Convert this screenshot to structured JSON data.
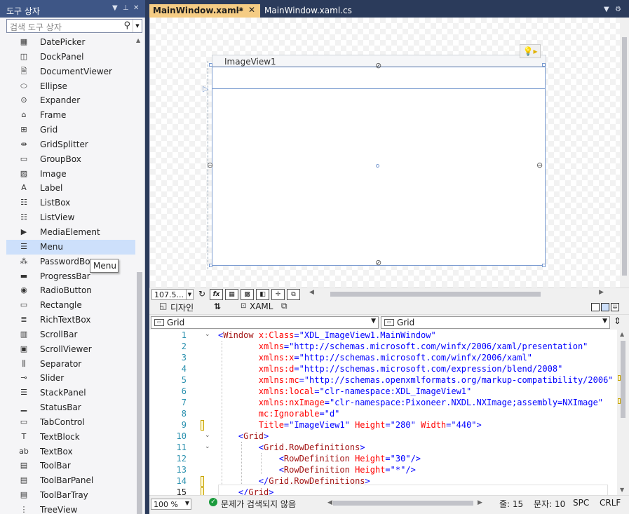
{
  "toolbox": {
    "title": "도구 상자",
    "search_placeholder": "검색 도구 상자",
    "items": [
      {
        "label": "DatePicker",
        "icon": "▦"
      },
      {
        "label": "DockPanel",
        "icon": "◫"
      },
      {
        "label": "DocumentViewer",
        "icon": "🗎"
      },
      {
        "label": "Ellipse",
        "icon": "⬭"
      },
      {
        "label": "Expander",
        "icon": "⊙"
      },
      {
        "label": "Frame",
        "icon": "⌂"
      },
      {
        "label": "Grid",
        "icon": "⊞"
      },
      {
        "label": "GridSplitter",
        "icon": "⇹"
      },
      {
        "label": "GroupBox",
        "icon": "▭"
      },
      {
        "label": "Image",
        "icon": "▨"
      },
      {
        "label": "Label",
        "icon": "A"
      },
      {
        "label": "ListBox",
        "icon": "☷"
      },
      {
        "label": "ListView",
        "icon": "☷"
      },
      {
        "label": "MediaElement",
        "icon": "▶"
      },
      {
        "label": "Menu",
        "icon": "☰",
        "selected": true
      },
      {
        "label": "PasswordBox",
        "icon": "⁂"
      },
      {
        "label": "ProgressBar",
        "icon": "▬"
      },
      {
        "label": "RadioButton",
        "icon": "◉"
      },
      {
        "label": "Rectangle",
        "icon": "▭"
      },
      {
        "label": "RichTextBox",
        "icon": "≣"
      },
      {
        "label": "ScrollBar",
        "icon": "▥"
      },
      {
        "label": "ScrollViewer",
        "icon": "▣"
      },
      {
        "label": "Separator",
        "icon": "⫼"
      },
      {
        "label": "Slider",
        "icon": "⊸"
      },
      {
        "label": "StackPanel",
        "icon": "☰"
      },
      {
        "label": "StatusBar",
        "icon": "▁"
      },
      {
        "label": "TabControl",
        "icon": "▭"
      },
      {
        "label": "TextBlock",
        "icon": "T"
      },
      {
        "label": "TextBox",
        "icon": "ab"
      },
      {
        "label": "ToolBar",
        "icon": "▤"
      },
      {
        "label": "ToolBarPanel",
        "icon": "▤"
      },
      {
        "label": "ToolBarTray",
        "icon": "▤"
      },
      {
        "label": "TreeView",
        "icon": "⋮"
      }
    ],
    "tooltip": "Menu"
  },
  "tabs": {
    "active": "MainWindow.xaml*",
    "pin": "⊸",
    "close": "✕",
    "second": "MainWindow.xaml.cs"
  },
  "designer": {
    "window_title": "ImageView1",
    "zoom": "107.5...",
    "fx": "fx"
  },
  "split": {
    "design_tab": "디자인",
    "swap_icon": "⇅",
    "xaml_tab": "XAML"
  },
  "nav": {
    "left": "Grid",
    "right": "Grid"
  },
  "code": {
    "line_numbers": [
      "1",
      "2",
      "3",
      "4",
      "5",
      "6",
      "7",
      "8",
      "9",
      "10",
      "11",
      "12",
      "13",
      "14",
      "15"
    ],
    "lines": [
      [
        [
          "br",
          "<"
        ],
        [
          "tg",
          "Window"
        ],
        [
          "at",
          " x:Class"
        ],
        [
          "br",
          "="
        ],
        [
          "va",
          "\"XDL_ImageView1.MainWindow\""
        ]
      ],
      [
        [
          "at",
          "        xmlns"
        ],
        [
          "br",
          "="
        ],
        [
          "va",
          "\"http://schemas.microsoft.com/winfx/2006/xaml/presentation\""
        ]
      ],
      [
        [
          "at",
          "        xmlns:x"
        ],
        [
          "br",
          "="
        ],
        [
          "va",
          "\"http://schemas.microsoft.com/winfx/2006/xaml\""
        ]
      ],
      [
        [
          "at",
          "        xmlns:d"
        ],
        [
          "br",
          "="
        ],
        [
          "va",
          "\"http://schemas.microsoft.com/expression/blend/2008\""
        ]
      ],
      [
        [
          "at",
          "        xmlns:mc"
        ],
        [
          "br",
          "="
        ],
        [
          "va",
          "\"http://schemas.openxmlformats.org/markup-compatibility/2006\""
        ]
      ],
      [
        [
          "at",
          "        xmlns:local"
        ],
        [
          "br",
          "="
        ],
        [
          "va",
          "\"clr-namespace:XDL_ImageView1\""
        ]
      ],
      [
        [
          "at",
          "        xmlns:nxImage"
        ],
        [
          "br",
          "="
        ],
        [
          "va",
          "\"clr-namespace:Pixoneer.NXDL.NXImage;assembly=NXImage\""
        ]
      ],
      [
        [
          "at",
          "        mc:Ignorable"
        ],
        [
          "br",
          "="
        ],
        [
          "va",
          "\"d\""
        ]
      ],
      [
        [
          "at",
          "        Title"
        ],
        [
          "br",
          "="
        ],
        [
          "va",
          "\"ImageView1\""
        ],
        [
          "at",
          " Height"
        ],
        [
          "br",
          "="
        ],
        [
          "va",
          "\"280\""
        ],
        [
          "at",
          " Width"
        ],
        [
          "br",
          "="
        ],
        [
          "va",
          "\"440\""
        ],
        [
          "br",
          ">"
        ]
      ],
      [
        [
          "br",
          "    <"
        ],
        [
          "tg",
          "Grid"
        ],
        [
          "br",
          ">"
        ]
      ],
      [
        [
          "br",
          "        <"
        ],
        [
          "tg",
          "Grid.RowDefinitions"
        ],
        [
          "br",
          ">"
        ]
      ],
      [
        [
          "br",
          "            <"
        ],
        [
          "tg",
          "RowDefinition"
        ],
        [
          "at",
          " Height"
        ],
        [
          "br",
          "="
        ],
        [
          "va",
          "\"30\""
        ],
        [
          "br",
          "/>"
        ]
      ],
      [
        [
          "br",
          "            <"
        ],
        [
          "tg",
          "RowDefinition"
        ],
        [
          "at",
          " Height"
        ],
        [
          "br",
          "="
        ],
        [
          "va",
          "\"*\""
        ],
        [
          "br",
          "/>"
        ]
      ],
      [
        [
          "br",
          "        </"
        ],
        [
          "tg",
          "Grid.RowDefinitions"
        ],
        [
          "br",
          ">"
        ]
      ],
      [
        [
          "br",
          "    </"
        ],
        [
          "tg",
          "Grid"
        ],
        [
          "br",
          ">"
        ]
      ]
    ]
  },
  "status": {
    "zoom": "100 %",
    "issues": "문제가 검색되지 않음",
    "line": "줄: 15",
    "col": "문자: 10",
    "spc": "SPC",
    "crlf": "CRLF"
  }
}
